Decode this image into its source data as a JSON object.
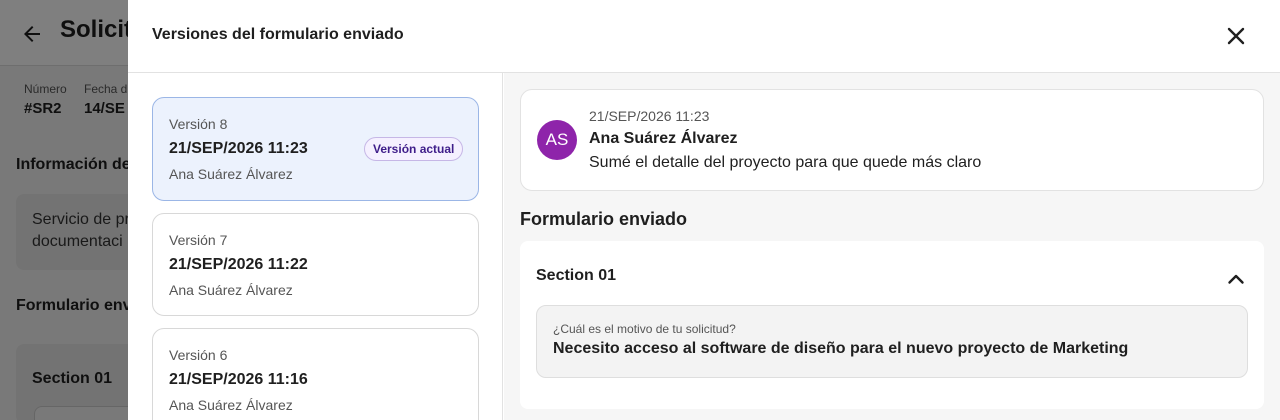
{
  "background": {
    "title": "Solicit",
    "meta": [
      {
        "label": "Número",
        "value": "#SR2"
      },
      {
        "label": "Fecha d",
        "value": "14/SE"
      }
    ],
    "info_heading": "Información de",
    "info_card_lines": [
      "Servicio de pr",
      "documentaci"
    ],
    "form_heading": "Formulario envi",
    "section_title": "Section 01"
  },
  "modal": {
    "title": "Versiones del formulario enviado",
    "versions": [
      {
        "label": "Versión 8",
        "date": "21/SEP/2026 11:23",
        "author": "Ana Suárez Álvarez",
        "badge": "Versión actual"
      },
      {
        "label": "Versión 7",
        "date": "21/SEP/2026 11:22",
        "author": "Ana Suárez Álvarez"
      },
      {
        "label": "Versión 6",
        "date": "21/SEP/2026 11:16",
        "author": "Ana Suárez Álvarez"
      }
    ],
    "comment": {
      "initials": "AS",
      "date": "21/SEP/2026 11:23",
      "author": "Ana Suárez Álvarez",
      "text": "Sumé el detalle del proyecto para que quede más claro"
    },
    "form": {
      "title": "Formulario enviado",
      "section_title": "Section 01",
      "question": "¿Cuál es el motivo de tu solicitud?",
      "answer": "Necesito acceso al software de diseño para el nuevo proyecto de Marketing"
    }
  },
  "colors": {
    "accent_active": "#ecf2fd",
    "avatar": "#8e24aa",
    "badge_text": "#3f1d8a"
  }
}
